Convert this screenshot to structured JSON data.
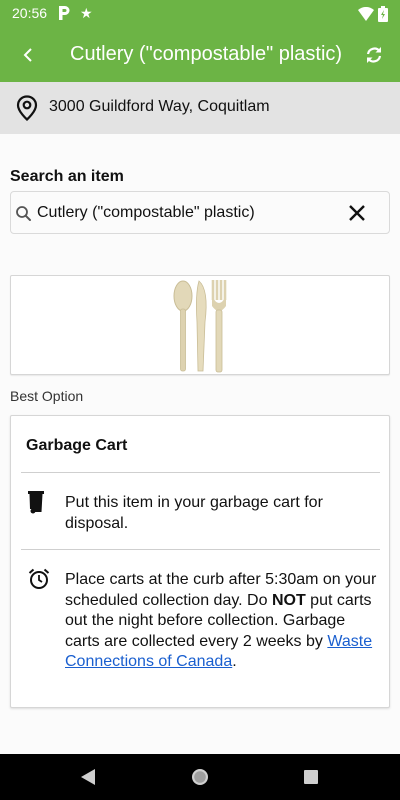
{
  "status_bar": {
    "time": "20:56"
  },
  "app_bar": {
    "title": "Cutlery (\"compostable\" plastic)"
  },
  "location": {
    "address": "3000 Guildford Way, Coquitlam"
  },
  "search": {
    "label": "Search an item",
    "value": "Cutlery (\"compostable\" plastic)"
  },
  "best_option": {
    "label": "Best Option"
  },
  "option": {
    "title": "Garbage Cart",
    "instruction": "Put this item in your garbage cart for disposal.",
    "schedule_before": "Place carts at the curb after 5:30am on your scheduled collection day. Do ",
    "schedule_bold": "NOT",
    "schedule_after": " put carts out the night before collection. Garbage carts are collected every 2 weeks by ",
    "provider_link": "Waste Connections of Canada",
    "schedule_end": "."
  },
  "colors": {
    "accent": "#6cb445",
    "link": "#1a5fcf"
  },
  "icons": {
    "back": "back-arrow-icon",
    "refresh": "refresh-icon",
    "location": "location-pin-icon",
    "search": "search-icon",
    "clear": "close-icon",
    "cart": "garbage-cart-icon",
    "clock": "alarm-clock-icon"
  }
}
